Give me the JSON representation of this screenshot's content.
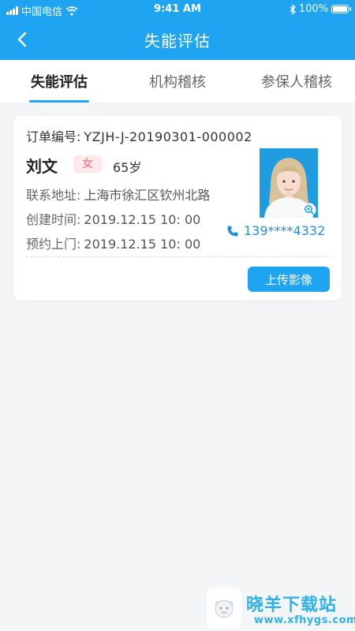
{
  "status_bar": {
    "carrier": "中国电信",
    "time": "9:41 AM",
    "battery": "100%"
  },
  "navbar": {
    "title": "失能评估"
  },
  "tabs": [
    {
      "label": "失能评估",
      "active": true
    },
    {
      "label": "机构稽核",
      "active": false
    },
    {
      "label": "参保人稽核",
      "active": false
    }
  ],
  "card": {
    "order_label": "订单编号:",
    "order_no": "YZJH-J-20190301-000002",
    "name": "刘文",
    "gender": "女",
    "age": "65岁",
    "address_label": "联系地址:",
    "address": "上海市徐汇区钦州北路",
    "created_label": "创建时间:",
    "created": "2019.12.15 10: 00",
    "appointment_label": "预约上门:",
    "appointment": "2019.12.15 10: 00",
    "phone": "139****4332",
    "upload_button": "上传影像"
  },
  "watermark": {
    "text": "晓羊下载站",
    "url": "www.xfhygs.com"
  },
  "colors": {
    "primary": "#1ea4f0",
    "gender_bg": "#fde8ea",
    "gender_text": "#f16b7a",
    "phone": "#1e8fe0"
  },
  "icons": [
    "back-arrow-icon",
    "signal-icon",
    "wifi-icon",
    "bluetooth-icon",
    "battery-icon",
    "zoom-icon",
    "phone-icon"
  ]
}
